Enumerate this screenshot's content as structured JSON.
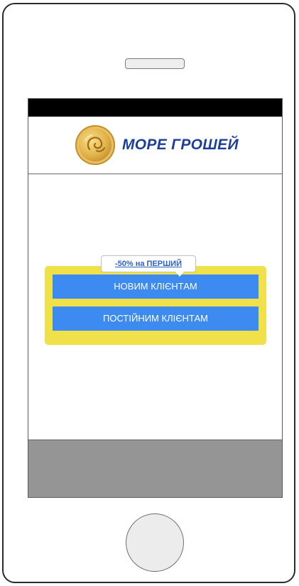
{
  "logo": {
    "text": "МОРЕ ГРОШЕЙ",
    "icon": "gold-coin-icon"
  },
  "promo": {
    "tooltip_text": "-50% на ПЕРШИЙ",
    "new_clients_label": "НОВИМ КЛІЄНТАМ",
    "regular_clients_label": "ПОСТІЙНИМ КЛІЄНТАМ"
  },
  "colors": {
    "promo_background": "#f0e14a",
    "button_blue": "#3d8bf0",
    "brand_blue": "#1d3f9a",
    "footer_gray": "#959595"
  }
}
